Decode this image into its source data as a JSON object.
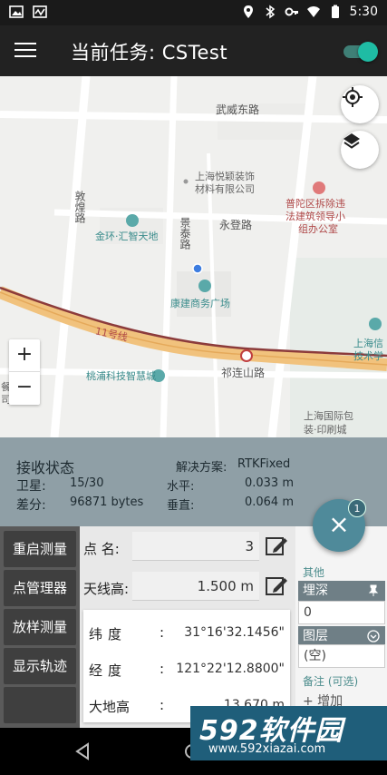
{
  "status_bar": {
    "time": "5:30",
    "left_icons": [
      "image-icon",
      "activity-icon"
    ],
    "right_icons": [
      "location-icon",
      "bluetooth-icon",
      "key-icon",
      "wifi-icon",
      "battery-icon"
    ]
  },
  "app_bar": {
    "title": "当前任务: CSTest",
    "toggle_on": true,
    "accent": "#1fbca4"
  },
  "map": {
    "labels": {
      "road_north": "武威东路",
      "road_dunhuang": "敦煌路",
      "road_jingtai": "景泰路",
      "road_yongdeng": "永登路",
      "road_qilianshan": "祁连山路",
      "metro_line": "11号线",
      "poi_yueying": "上海悦颖装饰材料有限公司",
      "poi_yueying_1": "上海悦颖装饰",
      "poi_yueying_2": "材料有限公司",
      "poi_jinhuan": "金环·汇智天地",
      "poi_kangjian": "康建商务广场",
      "poi_taopu": "桃浦科技智慧城",
      "poi_putuo": "普陀区拆除违法建筑领导小组办公室",
      "poi_putuo_1": "普陀区拆除违",
      "poi_putuo_2": "法建筑领导小",
      "poi_putuo_3": "组办公室",
      "poi_shanghai_info": "上海信技术学",
      "poi_shanghai_info_1": "上海信",
      "poi_shanghai_info_2": "技术学",
      "poi_print": "上海国际包装·印刷城",
      "poi_print_1": "上海国际包",
      "poi_print_2": "装·印刷城",
      "edge_top_right": "上海",
      "edge_left_1": "餐",
      "edge_left_2": "司"
    },
    "zoom_in": "+",
    "zoom_out": "−"
  },
  "receive_panel": {
    "title": "接收状态",
    "solution_label": "解决方案:",
    "solution_value": "RTKFixed",
    "satellite_label": "卫星:",
    "satellite_value": "15/30",
    "horizontal_label": "水平:",
    "horizontal_value": "0.033 m",
    "diff_label": "差分:",
    "diff_value": "96871 bytes",
    "vertical_label": "垂直:",
    "vertical_value": "0.064 m"
  },
  "fab": {
    "label": "×",
    "badge": "1"
  },
  "side_buttons": [
    "重启测量",
    "点管理器",
    "放样测量",
    "显示轨迹"
  ],
  "fields": {
    "point_name_label": "点 名:",
    "point_name_value": "3",
    "antenna_label": "天线高:",
    "antenna_value": "1.500 m"
  },
  "coords": {
    "lat_label": "纬度",
    "lat_value": "31°16'32.1456\"",
    "lon_label": "经度",
    "lon_value": "121°22'12.8800\"",
    "height_label": "大地高",
    "height_value": "13.670 m",
    "colon": ":"
  },
  "right_panel": {
    "other_heading": "其他",
    "depth_label": "埋深",
    "depth_value": "0",
    "layer_label": "图层",
    "layer_value": "(空)",
    "remark_label": "备注 (可选)",
    "add_label": "+ 增加"
  },
  "watermark": {
    "brand": "592软件园",
    "url": "www.592xiazai.com"
  }
}
